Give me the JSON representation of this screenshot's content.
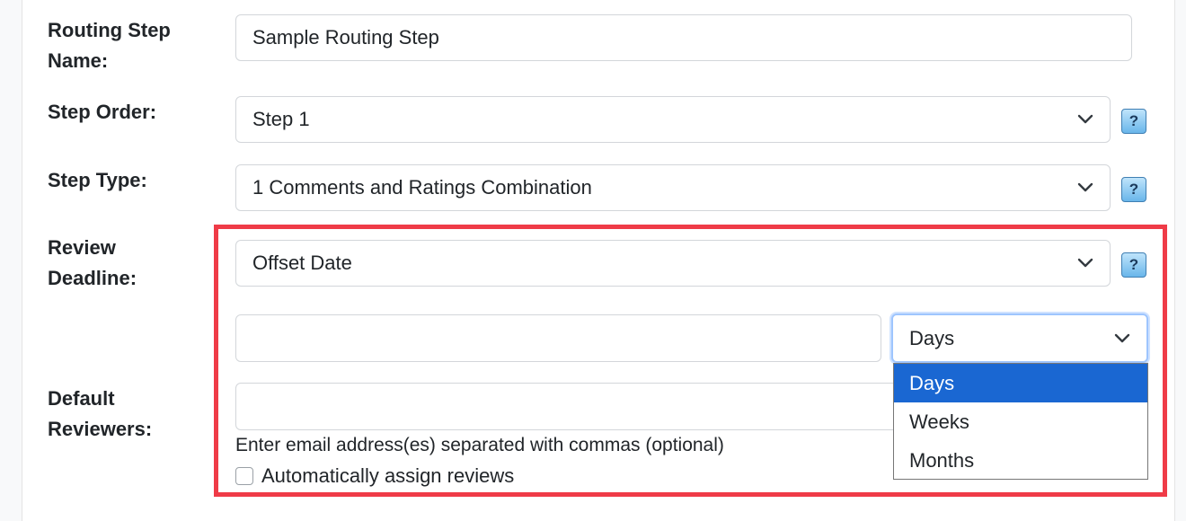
{
  "form": {
    "routing_step_name": {
      "label_line1": "Routing Step",
      "label_line2": "Name:",
      "value": "Sample Routing Step"
    },
    "step_order": {
      "label": "Step Order:",
      "value": "Step 1",
      "help": "?"
    },
    "step_type": {
      "label": "Step Type:",
      "value": "1 Comments and Ratings Combination",
      "help": "?"
    },
    "review_deadline": {
      "label_line1": "Review",
      "label_line2": "Deadline:",
      "value": "Offset Date",
      "help": "?",
      "offset_amount": "",
      "unit": {
        "value": "Days",
        "options": [
          "Days",
          "Weeks",
          "Months"
        ],
        "selected_index": 0
      }
    },
    "default_reviewers": {
      "label_line1": "Default",
      "label_line2": "Reviewers:",
      "value": "",
      "help_text": "Enter email address(es) separated with commas (optional)",
      "auto_assign_label": "Automatically assign reviews",
      "auto_assign_checked": false
    }
  },
  "colors": {
    "highlight_border": "#ef3b47",
    "selected_option_bg": "#1a67d2",
    "help_button": "#69b6ea"
  }
}
